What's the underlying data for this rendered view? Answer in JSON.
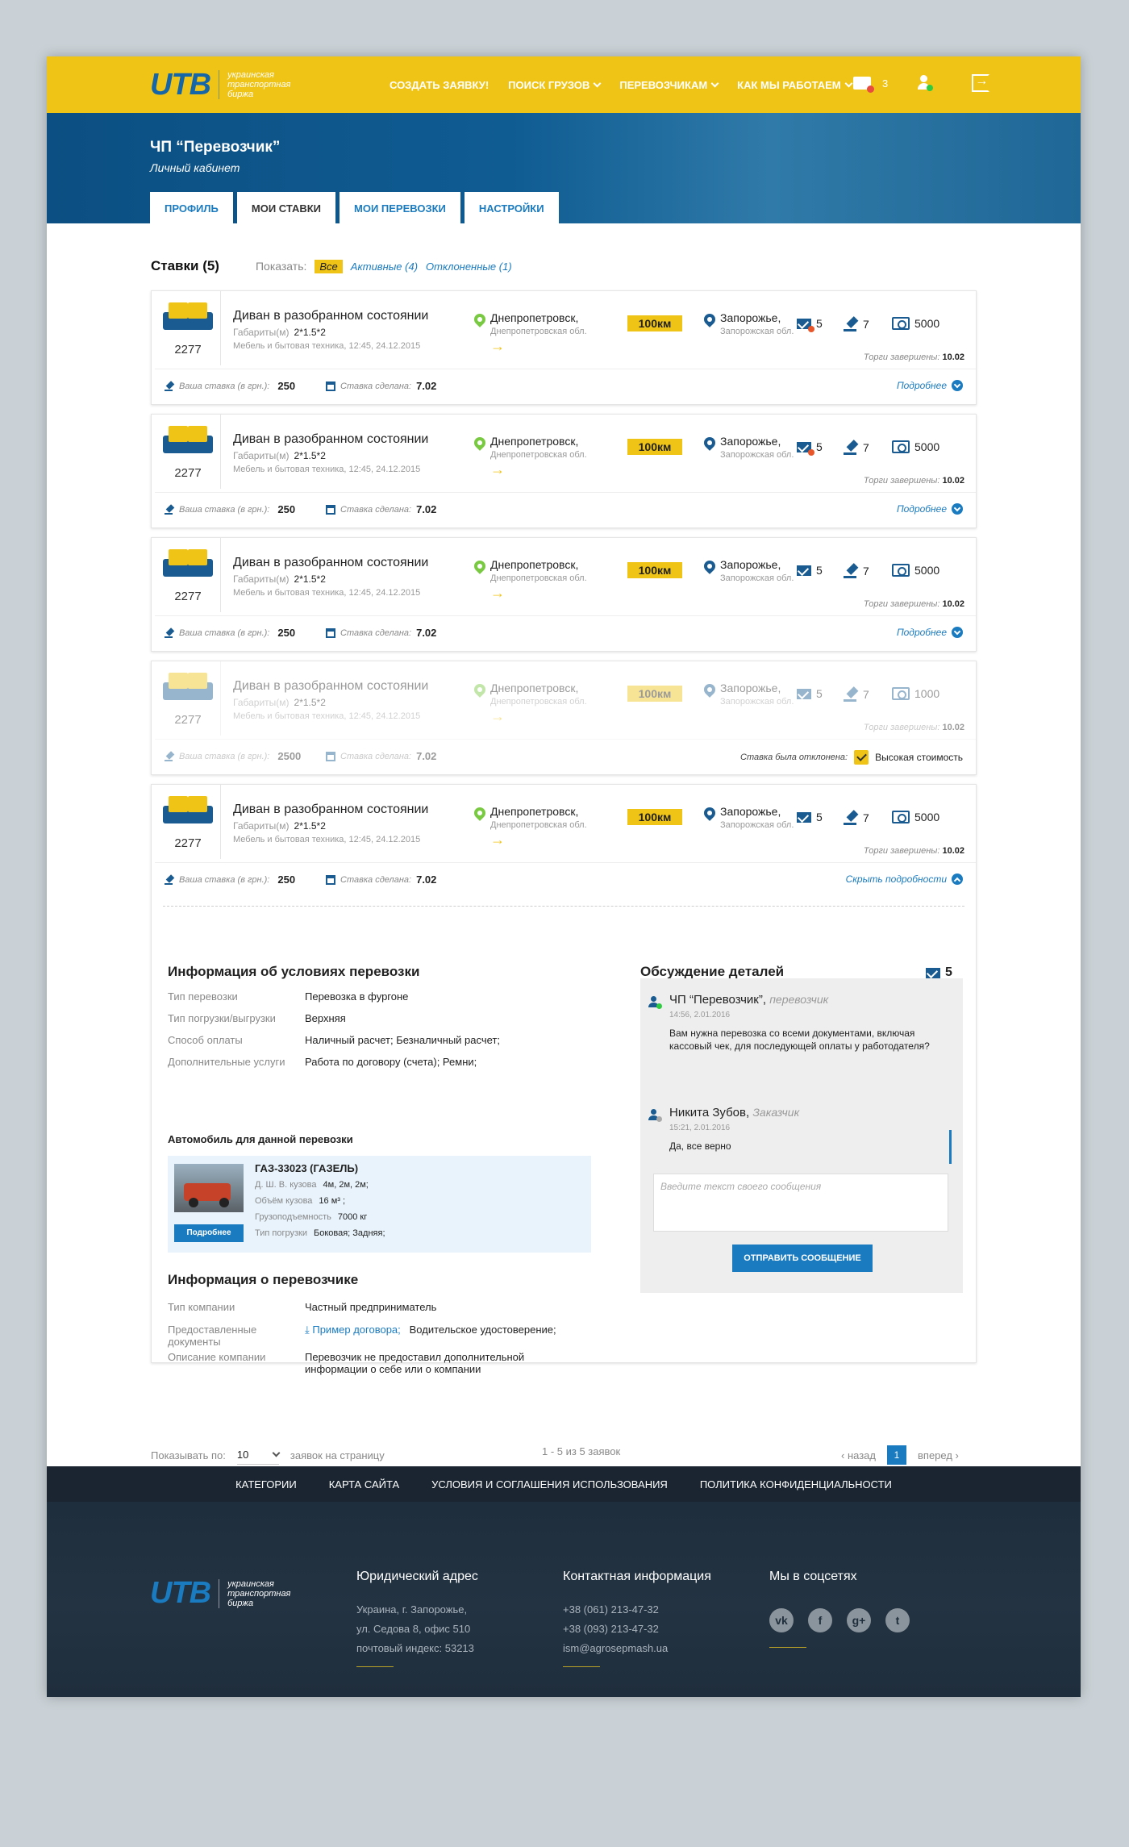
{
  "header": {
    "logo": "UTB",
    "logo_text": [
      "украинская",
      "транспортная",
      "биржа"
    ],
    "nav": [
      {
        "label": "Создать заявку!",
        "dropdown": false
      },
      {
        "label": "Поиск грузов",
        "dropdown": true
      },
      {
        "label": "Перевозчикам",
        "dropdown": true
      },
      {
        "label": "Как мы работаем",
        "dropdown": true
      }
    ],
    "messages_count": "3"
  },
  "hero": {
    "company": "ЧП “Перевозчик”",
    "subtitle": "Личный кабинет",
    "tabs": [
      "Профиль",
      "Мои ставки",
      "Мои перевозки",
      "Настройки"
    ]
  },
  "stakes": {
    "title": "Ставки (5)",
    "show_label": "Показать:",
    "filters": [
      "Все",
      "Активные (4)",
      "Отклоненные (1)"
    ]
  },
  "cards": [
    {
      "num": "2277",
      "title": "Диван в разобранном состоянии",
      "dim_label": "Габариты(м)",
      "dim": "2*1.5*2",
      "meta": "Мебель и бытовая техника, 12:45, 24.12.2015",
      "from": "Днепропетровск,",
      "from_sub": "Днепропетровская обл.",
      "km": "100км",
      "to": "Запорожье,",
      "to_sub": "Запорожская обл.",
      "msgs": "5",
      "bids": "7",
      "price": "5000",
      "ended_label": "Торги завершены:",
      "ended": "10.02",
      "bid_label": "Ваша ставка (в грн.):",
      "bid": "250",
      "made_label": "Ставка сделана:",
      "made": "7.02",
      "more": "Подробнее"
    },
    {
      "num": "2277",
      "title": "Диван в разобранном состоянии",
      "dim_label": "Габариты(м)",
      "dim": "2*1.5*2",
      "meta": "Мебель и бытовая техника, 12:45, 24.12.2015",
      "from": "Днепропетровск,",
      "from_sub": "Днепропетровская обл.",
      "km": "100км",
      "to": "Запорожье,",
      "to_sub": "Запорожская обл.",
      "msgs": "5",
      "bids": "7",
      "price": "5000",
      "ended_label": "Торги завершены:",
      "ended": "10.02",
      "bid_label": "Ваша ставка (в грн.):",
      "bid": "250",
      "made_label": "Ставка сделана:",
      "made": "7.02",
      "more": "Подробнее"
    },
    {
      "num": "2277",
      "title": "Диван в разобранном состоянии",
      "dim_label": "Габариты(м)",
      "dim": "2*1.5*2",
      "meta": "Мебель и бытовая техника, 12:45, 24.12.2015",
      "from": "Днепропетровск,",
      "from_sub": "Днепропетровская обл.",
      "km": "100км",
      "to": "Запорожье,",
      "to_sub": "Запорожская обл.",
      "msgs": "5",
      "bids": "7",
      "price": "5000",
      "ended_label": "Торги завершены:",
      "ended": "10.02",
      "bid_label": "Ваша ставка (в грн.):",
      "bid": "250",
      "made_label": "Ставка сделана:",
      "made": "7.02",
      "more": "Подробнее"
    },
    {
      "num": "2277",
      "title": "Диван в разобранном состоянии",
      "dim_label": "Габариты(м)",
      "dim": "2*1.5*2",
      "meta": "Мебель и бытовая техника, 12:45, 24.12.2015",
      "from": "Днепропетровск,",
      "from_sub": "Днепропетровская обл.",
      "km": "100км",
      "to": "Запорожье,",
      "to_sub": "Запорожская обл.",
      "msgs": "5",
      "bids": "7",
      "price": "1000",
      "ended_label": "Торги завершены:",
      "ended": "10.02",
      "bid_label": "Ваша ставка (в грн.):",
      "bid": "2500",
      "made_label": "Ставка сделана:",
      "made": "7.02",
      "rejected_label": "Ставка была отклонена:",
      "reason": "Высокая стоимость"
    },
    {
      "num": "2277",
      "title": "Диван в разобранном состоянии",
      "dim_label": "Габариты(м)",
      "dim": "2*1.5*2",
      "meta": "Мебель и бытовая техника, 12:45, 24.12.2015",
      "from": "Днепропетровск,",
      "from_sub": "Днепропетровская обл.",
      "km": "100км",
      "to": "Запорожье,",
      "to_sub": "Запорожская обл.",
      "msgs": "5",
      "bids": "7",
      "price": "5000",
      "ended_label": "Торги завершены:",
      "ended": "10.02",
      "bid_label": "Ваша ставка (в грн.):",
      "bid": "250",
      "made_label": "Ставка сделана:",
      "made": "7.02",
      "more": "Скрыть подробности"
    }
  ],
  "details": {
    "conditions_title": "Информация об условиях перевозки",
    "conditions": [
      {
        "k": "Тип перевозки",
        "v": "Перевозка в фургоне"
      },
      {
        "k": "Тип погрузки/выгрузки",
        "v": "Верхняя"
      },
      {
        "k": "Способ оплаты",
        "v": "Наличный расчет;    Безналичный расчет;"
      },
      {
        "k": "Дополнительные услуги",
        "v": "Работа по договору (счета);    Ремни;"
      }
    ],
    "car_title": "Автомобиль для данной перевозки",
    "car": {
      "name": "ГАЗ-33023 (ГАЗЕЛЬ)",
      "button": "Подробнее",
      "rows": [
        {
          "k": "Д. Ш. В. кузова",
          "v": "4м, 2м, 2м;"
        },
        {
          "k": "Объём кузова",
          "v": "16 м³ ;"
        },
        {
          "k": "Грузоподъемность",
          "v": "7000 кг"
        },
        {
          "k": "Тип погрузки",
          "v": "Боковая; Задняя;"
        }
      ]
    },
    "carrier_title": "Информация о перевозчике",
    "carrier": [
      {
        "k": "Тип компании",
        "v": "Частный предприниматель"
      },
      {
        "k": "Предоставленные документы",
        "v_link": "Пример договора;",
        "v": "Водительское удостоверение;"
      },
      {
        "k": "Описание компании",
        "v": "Перевозчик не предоставил дополнительной информации о себе или о компании"
      }
    ],
    "chat_title": "Обсуждение деталей",
    "chat_count": "5",
    "messages": [
      {
        "name": "ЧП “Перевозчик”,",
        "role": "перевозчик",
        "time": "14:56, 2.01.2016",
        "text": "Вам нужна перевозка со всеми документами, включая кассовый чек, для последующей оплаты у работодателя?"
      },
      {
        "name": "Никита Зубов,",
        "role": "Заказчик",
        "time": "15:21, 2.01.2016",
        "text": "Да, все верно"
      }
    ],
    "input_placeholder": "Введите текст своего сообщения",
    "send": "Отправить сообщение"
  },
  "pagination": {
    "show_label": "Показывать по:",
    "per_page": "10",
    "per_page_suffix": "заявок на страницу",
    "range": "1 - 5 из 5 заявок",
    "prev": "назад",
    "current": "1",
    "next": "вперед"
  },
  "footer": {
    "nav": [
      "Категории",
      "Карта сайта",
      "Условия и соглашения использования",
      "Политика конфиденциальности"
    ],
    "address_title": "Юридический  адрес",
    "address": [
      "Украина, г. Запорожье,",
      "ул. Седова 8, офис 510",
      "почтовый индекс: 53213"
    ],
    "contacts_title": "Контактная информация",
    "contacts": [
      "+38 (061) 213-47-32",
      "+38 (093) 213-47-32",
      "ism@agrosepmash.ua"
    ],
    "social_title": "Мы в соцсетях",
    "social": [
      "vk",
      "f",
      "g+",
      "t"
    ]
  },
  "colors": {
    "accent": "#f0c417",
    "brand": "#1a5c91",
    "link": "#1a7bc0"
  }
}
